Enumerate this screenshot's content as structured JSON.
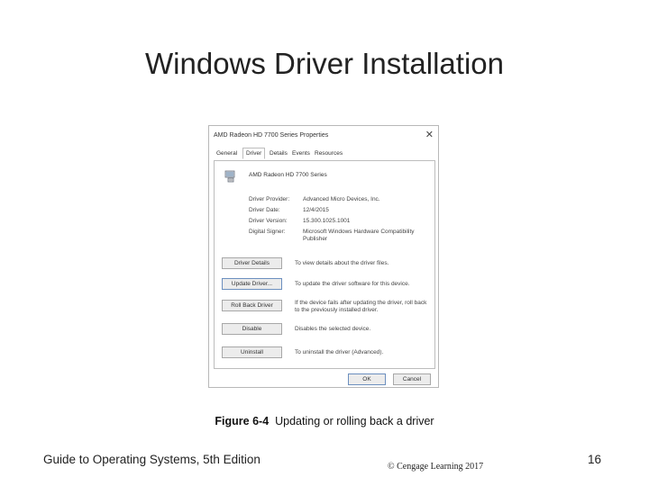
{
  "slide": {
    "title": "Windows Driver Installation"
  },
  "dialog": {
    "title": "AMD Radeon HD 7700 Series Properties",
    "tabs": [
      {
        "label": "General"
      },
      {
        "label": "Driver"
      },
      {
        "label": "Details"
      },
      {
        "label": "Events"
      },
      {
        "label": "Resources"
      }
    ],
    "active_tab": "Driver",
    "device_icon": "display-adapter-icon",
    "device_name": "AMD Radeon HD 7700 Series",
    "properties": [
      {
        "label": "Driver Provider:",
        "value": "Advanced Micro Devices, Inc."
      },
      {
        "label": "Driver Date:",
        "value": "12/4/2015"
      },
      {
        "label": "Driver Version:",
        "value": "15.300.1025.1001"
      },
      {
        "label": "Digital Signer:",
        "value": "Microsoft Windows Hardware Compatibility Publisher"
      }
    ],
    "buttons": [
      {
        "label": "Driver Details",
        "description": "To view details about the driver files."
      },
      {
        "label": "Update Driver...",
        "description": "To update the driver software for this device."
      },
      {
        "label": "Roll Back Driver",
        "description": "If the device fails after updating the driver, roll back to the previously installed driver."
      },
      {
        "label": "Disable",
        "description": "Disables the selected device."
      },
      {
        "label": "Uninstall",
        "description": "To uninstall the driver (Advanced)."
      }
    ],
    "ok_label": "OK",
    "cancel_label": "Cancel",
    "close_icon": "close-icon"
  },
  "caption": {
    "figure": "Figure 6-4",
    "text": "Updating or rolling back a driver"
  },
  "footer": {
    "book": "Guide to Operating Systems, 5th Edition",
    "copyright": "© Cengage Learning 2017",
    "page": "16"
  }
}
